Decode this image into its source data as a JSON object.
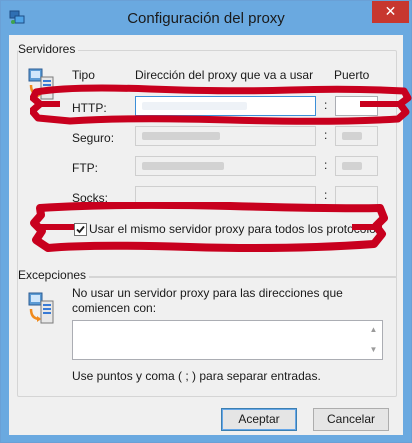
{
  "window": {
    "title": "Configuración del proxy",
    "close_glyph": "✕"
  },
  "servers": {
    "group_title": "Servidores",
    "col_type": "Tipo",
    "col_address": "Dirección del proxy que va a usar",
    "col_port": "Puerto",
    "rows": [
      {
        "label": "HTTP:",
        "colon": ":"
      },
      {
        "label": "Seguro:",
        "colon": ":"
      },
      {
        "label": "FTP:",
        "colon": ":"
      },
      {
        "label": "Socks:",
        "colon": ":"
      }
    ],
    "same_proxy_label": "Usar el mismo servidor proxy para todos los protocolos",
    "same_proxy_checked": true
  },
  "exceptions": {
    "group_title": "Excepciones",
    "description": [
      "No usar un servidor proxy para las direcciones que",
      "comiencen con:"
    ],
    "hint": "Use puntos y coma ( ; ) para separar entradas."
  },
  "buttons": {
    "ok": "Aceptar",
    "cancel": "Cancelar"
  },
  "colors": {
    "titlebar": "#6aa9e0",
    "close": "#c7372f",
    "highlight_marker": "#c8001e"
  },
  "icons": [
    "network-settings-icon",
    "proxy-computers-icon",
    "checkmark-icon",
    "scroll-up-icon",
    "scroll-down-icon"
  ]
}
